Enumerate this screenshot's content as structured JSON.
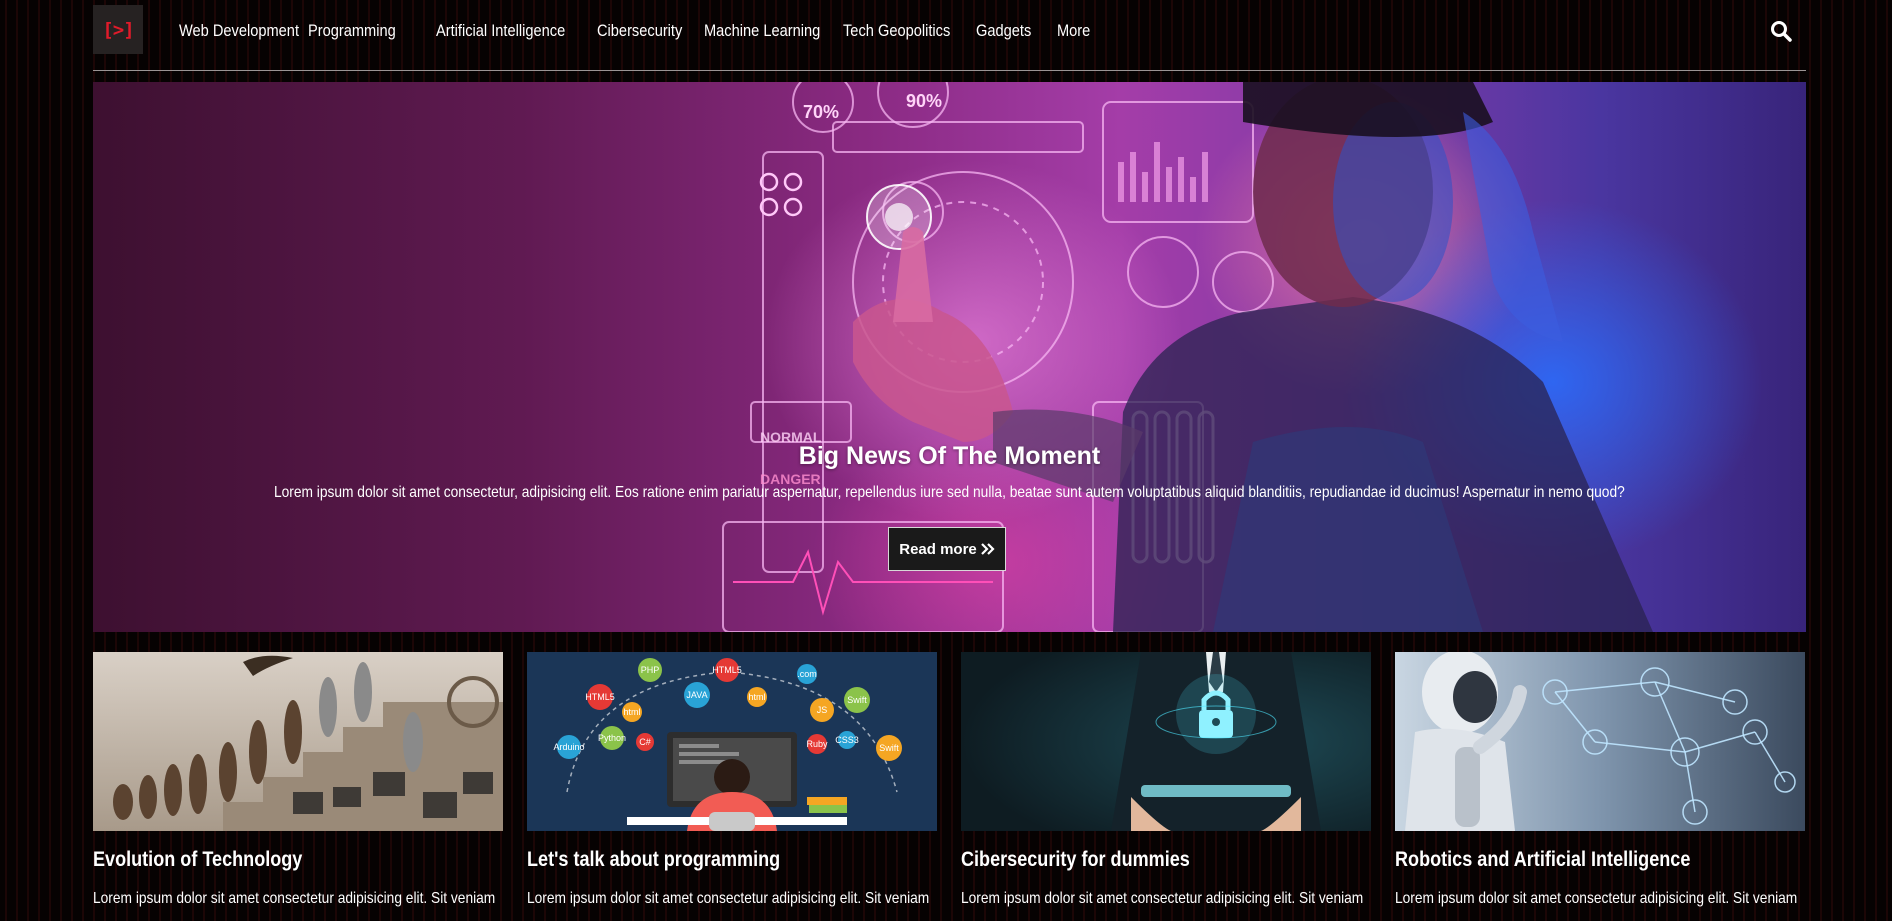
{
  "logo": {
    "text": "[>]"
  },
  "nav": {
    "items": [
      "Web Development",
      "Programming",
      "Artificial Intelligence",
      "Cibersecurity",
      "Machine Learning",
      "Tech Geopolitics",
      "Gadgets",
      "More"
    ],
    "search_icon": "search-icon"
  },
  "hero": {
    "title": "Big News Of The Moment",
    "text": "Lorem ipsum dolor sit amet consectetur, adipisicing elit. Eos ratione enim pariatur aspernatur, repellendus iure sed nulla, beatae sunt autem voluptatibus aliquid blanditiis, repudiandae id ducimus! Aspernatur in nemo quod?",
    "button_label": "Read more",
    "button_icon": "double-chevron-right-icon",
    "hud_labels": [
      "70%",
      "90%",
      "NORMAL",
      "DANGER"
    ]
  },
  "cards": [
    {
      "title": "Evolution of Technology",
      "text": "Lorem ipsum dolor sit amet consectetur adipisicing elit. Sit veniam"
    },
    {
      "title": "Let's talk about programming",
      "text": "Lorem ipsum dolor sit amet consectetur adipisicing elit. Sit veniam",
      "bubbles": [
        "PHP",
        "HTML5",
        "JAVA",
        "html",
        "JS",
        "Swift",
        "HTML5",
        "Python",
        "C#",
        "Ruby",
        "CSS3",
        "Swift",
        "Arduino",
        ".com"
      ]
    },
    {
      "title": "Cibersecurity for dummies",
      "text": "Lorem ipsum dolor sit amet consectetur adipisicing elit. Sit veniam"
    },
    {
      "title": "Robotics and Artificial Intelligence",
      "text": "Lorem ipsum dolor sit amet consectetur adipisicing elit. Sit veniam"
    }
  ],
  "colors": {
    "accent": "#e01b2a",
    "nav_text": "#ffffff",
    "background": "#060202"
  }
}
